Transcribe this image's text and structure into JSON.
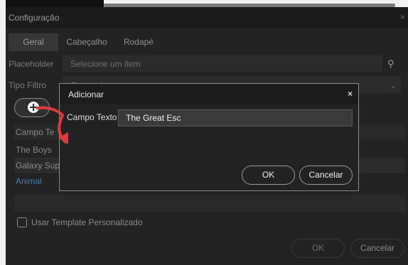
{
  "window": {
    "title": "Configuração",
    "close": "×"
  },
  "tabs": [
    {
      "label": "Geral",
      "active": true
    },
    {
      "label": "Cabeçalho",
      "active": false
    },
    {
      "label": "Rodapé",
      "active": false
    }
  ],
  "form": {
    "placeholder_label": "Placeholder",
    "placeholder_value": "Selecione um item",
    "filter_label": "Tipo Filtro",
    "filter_value": "Contendo"
  },
  "grid": {
    "header": "Campo Te",
    "rows": [
      "The Boys",
      "Galaxy Sup"
    ],
    "link": "Animal"
  },
  "options": {
    "custom_template_label": "Usar Template Personalizado"
  },
  "buttons": {
    "ok": "OK",
    "cancel": "Cancelar"
  },
  "modal": {
    "title": "Adicionar",
    "close": "×",
    "field_label": "Campo Texto",
    "field_value": "The Great Esc",
    "ok": "OK",
    "cancel": "Cancelar"
  },
  "colors": {
    "background": "#232323",
    "titlebar": "#1b1b1b",
    "link": "#3e7fb8",
    "annotation_arrow": "#e23a3a"
  },
  "icons": [
    "search-icon",
    "chevron-down-icon",
    "plus-icon",
    "close-icon"
  ]
}
